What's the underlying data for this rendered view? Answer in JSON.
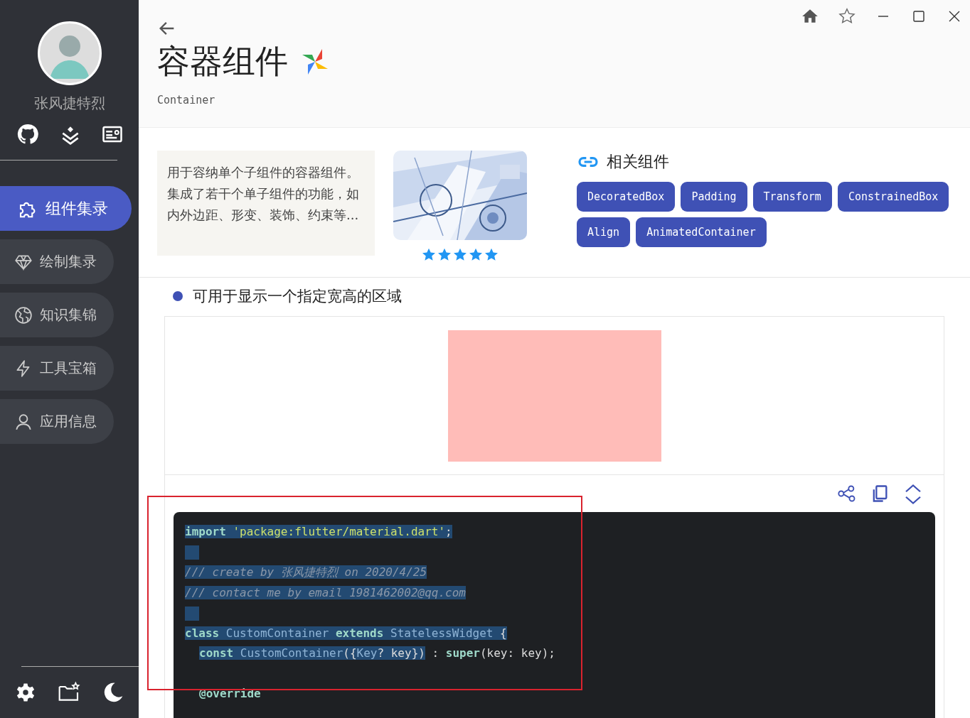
{
  "sidebar": {
    "user_name": "张风捷特烈",
    "nav_items": [
      {
        "label": "组件集录",
        "selected": true
      },
      {
        "label": "绘制集录",
        "selected": false
      },
      {
        "label": "知识集锦",
        "selected": false
      },
      {
        "label": "工具宝箱",
        "selected": false
      },
      {
        "label": "应用信息",
        "selected": false
      }
    ]
  },
  "header": {
    "title": "容器组件",
    "subtitle": "Container"
  },
  "intro": {
    "description": "用于容纳单个子组件的容器组件。集成了若干个单子组件的功能，如内外边距、形变、装饰、约束等...",
    "stars": 5
  },
  "related": {
    "title": "相关组件",
    "items": [
      "DecoratedBox",
      "Padding",
      "Transform",
      "ConstrainedBox",
      "Align",
      "AnimatedContainer"
    ]
  },
  "section": {
    "title": "可用于显示一个指定宽高的区域"
  },
  "code_lines": [
    {
      "kind": "code",
      "indented": false,
      "tokens": [
        {
          "kind": "keyword",
          "text": "import",
          "selected": true
        },
        {
          "kind": "string",
          "text": " 'package:flutter/material.dart'",
          "selected": true
        },
        {
          "kind": "plain",
          "text": ";",
          "selected": true
        }
      ]
    },
    {
      "kind": "blank",
      "selected": true
    },
    {
      "kind": "code",
      "indented": false,
      "tokens": [
        {
          "kind": "comment",
          "text": "/// create by 张风捷特烈 on 2020/4/25",
          "selected": true
        }
      ]
    },
    {
      "kind": "code",
      "indented": false,
      "tokens": [
        {
          "kind": "comment",
          "text": "/// contact me by email 1981462002@qq.com",
          "selected": true
        }
      ]
    },
    {
      "kind": "blank",
      "selected": true
    },
    {
      "kind": "code",
      "indented": false,
      "tokens": [
        {
          "kind": "keyword",
          "text": "class",
          "selected": true
        },
        {
          "kind": "type",
          "text": " CustomContainer",
          "selected": true
        },
        {
          "kind": "keyword",
          "text": " extends",
          "selected": true
        },
        {
          "kind": "type",
          "text": " StatelessWidget",
          "selected": true
        },
        {
          "kind": "plain",
          "text": " {",
          "selected": true
        }
      ]
    },
    {
      "kind": "code",
      "indented": true,
      "tokens": [
        {
          "kind": "keyword",
          "text": "const",
          "selected": true
        },
        {
          "kind": "type",
          "text": " CustomContainer",
          "selected": true
        },
        {
          "kind": "plain",
          "text": "({",
          "selected": true
        },
        {
          "kind": "type",
          "text": "Key",
          "selected": true
        },
        {
          "kind": "plain",
          "text": "? key})",
          "selected": true
        },
        {
          "kind": "plain",
          "text": " :",
          "selected": false
        },
        {
          "kind": "keyword",
          "text": " super",
          "selected": false
        },
        {
          "kind": "plain",
          "text": "(key: key);",
          "selected": false
        }
      ]
    },
    {
      "kind": "blank",
      "selected": false
    },
    {
      "kind": "code",
      "indented": true,
      "tokens": [
        {
          "kind": "keyword",
          "text": "@override",
          "selected": false
        }
      ]
    }
  ]
}
